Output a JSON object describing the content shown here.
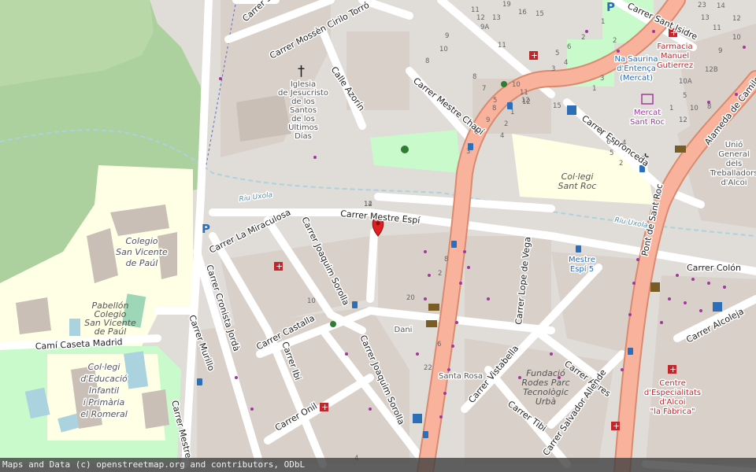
{
  "map": {
    "colors": {
      "background": "#e0dcd8",
      "building": "#d9d0c9",
      "park": "#c8facc",
      "wood": "#add19e",
      "school": "#ffffe5",
      "primary_road": "#fcd6a4",
      "secondary_road": "#f7fabf",
      "trunk_road": "#f9b29c",
      "residential": "#ffffff",
      "water": "#aad3df",
      "marker": "#e02020"
    },
    "streets": [
      "Carrer Sant Crisòfol",
      "Carrer Mossèn Cirilo Torró",
      "Calle Azorín",
      "Carrer Mestre Chapí",
      "Carrer Mestre Espí",
      "Carrer La Miraculosa",
      "Carrer Joaquim Sorolla",
      "Carrer Cronista Jordà",
      "Carrer Castalla",
      "Carrer Ibi",
      "Carrer Murillo",
      "Carrer Onil",
      "Carrer Joaquim Sorolla",
      "Carrer Lope de Vega",
      "Carrer Vistabella",
      "Carrer Agres",
      "Carrer Tibi",
      "Carrer Salvador Allende",
      "Carrer Alcoleja",
      "Carrer Colón",
      "Carrer Espronceda",
      "Alameda de Camilo Sesto",
      "Pont de Sant Roc",
      "Camí Caseta Madrid",
      "Carrer Mestre",
      "Carrer Sant Isidre",
      "Riu Uxola",
      "Riu Uxola"
    ],
    "pois": {
      "church": [
        "Iglesia",
        "de Jesucristo",
        "de los",
        "Santos",
        "de los",
        "Últimos",
        "Días"
      ],
      "school1": [
        "Colegio",
        "San Vicente",
        "de Paúl"
      ],
      "school2": [
        "Pabellón",
        "Colegio",
        "San Vicente",
        "de Paúl"
      ],
      "school3": [
        "Col·legi",
        "d'Educació",
        "Infantil",
        "i Primària",
        "el Romeral"
      ],
      "school4": [
        "Col·legi",
        "Sant Roc"
      ],
      "market1": [
        "Na Saurina",
        "d'Entença",
        "(Mercat)"
      ],
      "market2": [
        "Mercat",
        "Sant Roc"
      ],
      "pharmacy": [
        "Farmacia",
        "Manuel",
        "Gutierrez"
      ],
      "union": [
        "Unió",
        "General",
        "dels",
        "Treballadors",
        "d'Alcoi"
      ],
      "bus_stop": [
        "Mestre",
        "Espí 5"
      ],
      "dani": "Dani",
      "santa_rosa": "Santa Rosa",
      "fundacio": [
        "Fundació",
        "Rodes Parc",
        "Tecnològic",
        "Urbà"
      ],
      "centre": [
        "Centre",
        "d'Especialitats",
        "d'Alcoi",
        "\"la Fàbrica\""
      ]
    },
    "house_numbers": [
      "19",
      "16",
      "15",
      "11",
      "12",
      "13",
      "9A",
      "8",
      "9",
      "10",
      "5",
      "3",
      "4",
      "6",
      "2",
      "1",
      "11",
      "8",
      "7",
      "5",
      "6",
      "3",
      "4",
      "2",
      "1",
      "12",
      "11",
      "10",
      "8",
      "9",
      "6",
      "7",
      "4",
      "5",
      "2",
      "14",
      "13",
      "11",
      "12",
      "10",
      "9",
      "12",
      "15",
      "2",
      "1",
      "3",
      "10A",
      "12B",
      "1",
      "5",
      "12",
      "10",
      "8",
      "23",
      "14",
      "12",
      "20",
      "22",
      "10",
      "8",
      "6",
      "4",
      "2"
    ],
    "marker": "selected-location"
  },
  "attribution": "Maps and Data (c) openstreetmap.org and contributors, ODbL"
}
